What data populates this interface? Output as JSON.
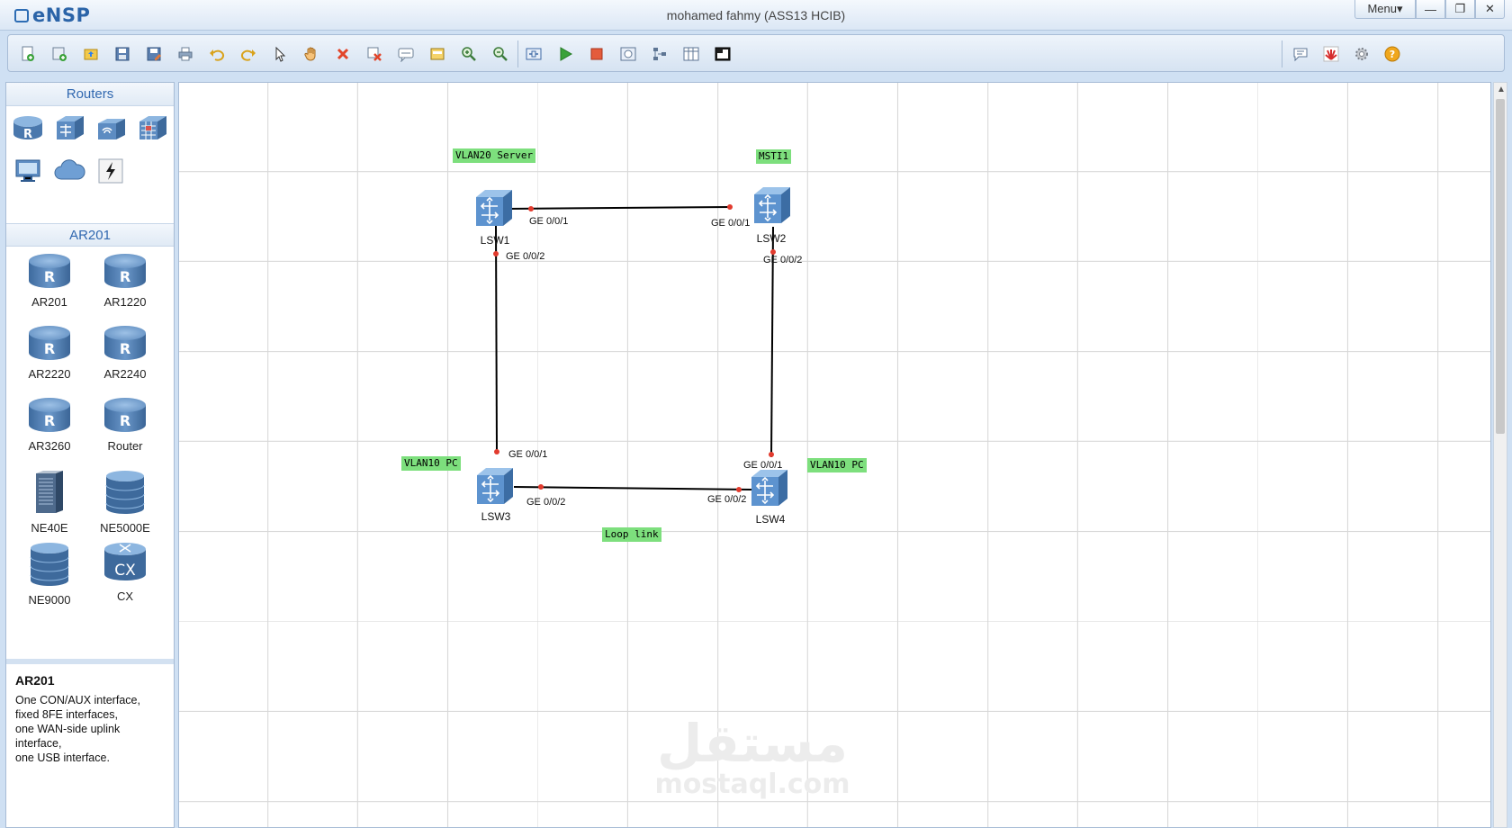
{
  "app": {
    "name": "eNSP",
    "window_title": "mohamed fahmy (ASS13 HCIB)",
    "menu_label": "Menu▾",
    "minimize_glyph": "—",
    "restore_glyph": "❐",
    "close_glyph": "✕"
  },
  "toolbar": {
    "left_icons": [
      "new-topology-icon",
      "new-device-icon",
      "open-icon",
      "save-icon",
      "save-as-icon",
      "print-icon",
      "undo-icon",
      "redo-icon",
      "select-icon",
      "pan-hand-icon",
      "delete-icon",
      "delete-link-icon",
      "add-text-icon",
      "palette-icon",
      "zoom-in-icon",
      "zoom-out-icon",
      "fit-icon",
      "start-device-icon",
      "stop-device-icon",
      "capture-icon",
      "topology-icon",
      "grid-icon",
      "console-icon"
    ],
    "right_icons": [
      "message-icon",
      "huawei-icon",
      "settings-icon",
      "help-icon"
    ]
  },
  "left_panel": {
    "category_title": "Routers",
    "category_icons": [
      "router-category-icon",
      "switch-category-icon",
      "wireless-category-icon",
      "firewall-category-icon",
      "pc-category-icon",
      "cloud-category-icon",
      "other-device-icon"
    ],
    "device_section_title": "AR201",
    "devices": [
      {
        "label": "AR201",
        "kind": "router"
      },
      {
        "label": "AR1220",
        "kind": "router"
      },
      {
        "label": "AR2220",
        "kind": "router"
      },
      {
        "label": "AR2240",
        "kind": "router"
      },
      {
        "label": "AR3260",
        "kind": "router"
      },
      {
        "label": "Router",
        "kind": "router"
      },
      {
        "label": "NE40E",
        "kind": "chassis"
      },
      {
        "label": "NE5000E",
        "kind": "stack"
      },
      {
        "label": "NE9000",
        "kind": "stack"
      },
      {
        "label": "CX",
        "kind": "cx"
      }
    ],
    "description": {
      "title": "AR201",
      "lines": [
        "One CON/AUX interface,",
        "fixed 8FE interfaces,",
        "one WAN-side uplink",
        "interface,",
        "one USB interface."
      ]
    }
  },
  "topology": {
    "switches": [
      {
        "id": "sw1",
        "name": "LSW1"
      },
      {
        "id": "sw2",
        "name": "LSW2"
      },
      {
        "id": "sw3",
        "name": "LSW3"
      },
      {
        "id": "sw4",
        "name": "LSW4"
      }
    ],
    "links": [
      {
        "from": "LSW1",
        "from_port": "GE 0/0/1",
        "to": "LSW2",
        "to_port": "GE 0/0/1"
      },
      {
        "from": "LSW1",
        "from_port": "GE 0/0/2",
        "to": "LSW3",
        "to_port": "GE 0/0/1"
      },
      {
        "from": "LSW2",
        "from_port": "GE 0/0/2",
        "to": "LSW4",
        "to_port": "GE 0/0/1"
      },
      {
        "from": "LSW3",
        "from_port": "GE 0/0/2",
        "to": "LSW4",
        "to_port": "GE 0/0/2"
      }
    ],
    "notes": {
      "vlan20_server": "VLAN20 Server",
      "msti1": "MSTI1",
      "vlan10_pc_left": "VLAN10 PC",
      "vlan10_pc_right": "VLAN10 PC",
      "loop_link": "Loop link"
    },
    "link_color": "#000000",
    "port_dot_color": "#e23b2e",
    "note_color": "#7ddf7d"
  },
  "watermark": {
    "arabic": "مستقل",
    "latin": "mostaql.com"
  }
}
